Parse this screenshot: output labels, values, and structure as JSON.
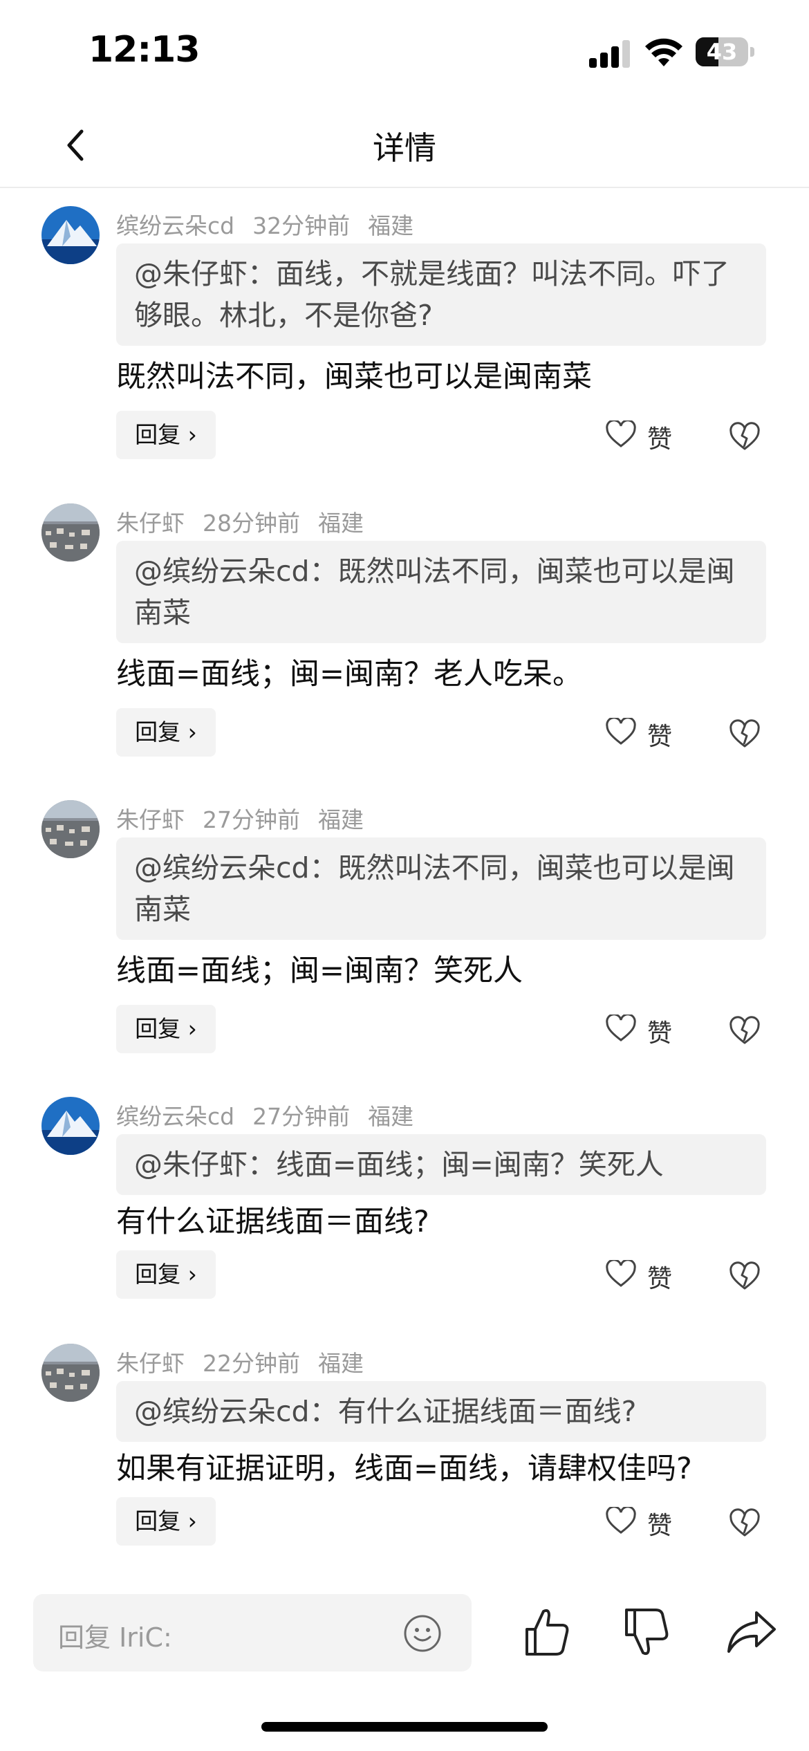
{
  "status": {
    "time": "12:13",
    "battery": "43",
    "battery_level": 0.43
  },
  "nav": {
    "title": "详情",
    "back_icon": "chevron-left-icon"
  },
  "comments": [
    {
      "author": "缤纷云朵cd",
      "time": "32分钟前",
      "location": "福建",
      "avatar": "mountain",
      "quote": "@朱仔虾：面线，不就是线面？叫法不同。吓了够眼。林北，不是你爸?",
      "text": "既然叫法不同，闽菜也可以是闽南菜",
      "reply_label": "回复",
      "like_label": "赞"
    },
    {
      "author": "朱仔虾",
      "time": "28分钟前",
      "location": "福建",
      "avatar": "city",
      "quote": "@缤纷云朵cd：既然叫法不同，闽菜也可以是闽南菜",
      "text": "线面=面线；闽=闽南？老人吃呆。",
      "reply_label": "回复",
      "like_label": "赞"
    },
    {
      "author": "朱仔虾",
      "time": "27分钟前",
      "location": "福建",
      "avatar": "city",
      "quote": "@缤纷云朵cd：既然叫法不同，闽菜也可以是闽南菜",
      "text": "线面=面线；闽=闽南？笑死人",
      "reply_label": "回复",
      "like_label": "赞"
    },
    {
      "author": "缤纷云朵cd",
      "time": "27分钟前",
      "location": "福建",
      "avatar": "mountain",
      "quote": "@朱仔虾：线面=面线；闽=闽南？笑死人",
      "text": "有什么证据线面＝面线?",
      "reply_label": "回复",
      "like_label": "赞"
    },
    {
      "author": "朱仔虾",
      "time": "22分钟前",
      "location": "福建",
      "avatar": "city",
      "quote": "@缤纷云朵cd：有什么证据线面＝面线?",
      "text": "如果有证据证明，线面=面线，请肆权佳吗?",
      "reply_label": "回复",
      "like_label": "赞"
    }
  ],
  "bottom_bar": {
    "input_placeholder": "回复 IriC:",
    "icons": [
      "emoji-icon",
      "thumbs-up-icon",
      "thumbs-down-icon",
      "share-icon"
    ]
  }
}
